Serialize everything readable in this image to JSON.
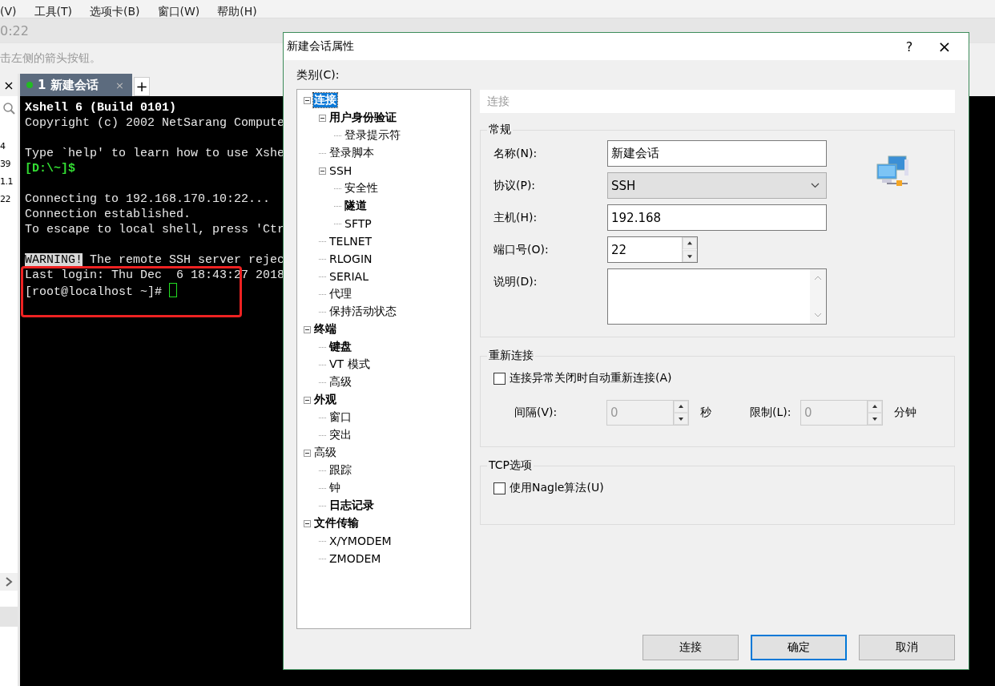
{
  "menu_bar": {
    "items": [
      "(V)",
      "工具(T)",
      "选项卡(B)",
      "窗口(W)",
      "帮助(H)"
    ]
  },
  "address_bar": {
    "value": "0:22"
  },
  "hint_bar": {
    "text": "击左侧的箭头按钮。"
  },
  "side_panel": {
    "close": "×",
    "entries": [
      "4",
      "39",
      "1.1",
      "22"
    ]
  },
  "session_tabs": [
    {
      "label": "1 新建会话",
      "connected": true,
      "selected": true,
      "close": "×"
    }
  ],
  "add_tab": "+",
  "terminal": {
    "lines": [
      {
        "kind": "bold",
        "text": "Xshell 6 (Build 0101)"
      },
      {
        "kind": "plain",
        "text": "Copyright (c) 2002 NetSarang Compute"
      },
      {
        "kind": "blank"
      },
      {
        "kind": "plain",
        "text": "Type `help' to learn how to use Xshe"
      },
      {
        "kind": "prompt",
        "text": "[D:\\~]$"
      },
      {
        "kind": "blank"
      },
      {
        "kind": "plain",
        "text": "Connecting to 192.168.170.10:22..."
      },
      {
        "kind": "plain",
        "text": "Connection established."
      },
      {
        "kind": "plain",
        "text": "To escape to local shell, press 'Ctr"
      },
      {
        "kind": "blank"
      },
      {
        "kind": "warning",
        "highlight": "WARNING!",
        "text": " The remote SSH server rejec"
      },
      {
        "kind": "plain",
        "text": "Last login: Thu Dec  6 18:43:27 2018"
      },
      {
        "kind": "input",
        "text": "[root@localhost ~]# "
      }
    ]
  },
  "dialog": {
    "title": "新建会话属性",
    "help": "?",
    "close": "×",
    "category_label": "类别(C):",
    "tree": [
      {
        "label": "连接",
        "bold": true,
        "selected": true,
        "expanded": true,
        "children": [
          {
            "label": "用户身份验证",
            "bold": true,
            "selected": false,
            "expanded": true,
            "children": [
              {
                "label": "登录提示符",
                "bold": false,
                "selected": false
              }
            ]
          },
          {
            "label": "登录脚本",
            "bold": false,
            "selected": false
          },
          {
            "label": "SSH",
            "bold": false,
            "selected": false,
            "expanded": true,
            "children": [
              {
                "label": "安全性",
                "bold": false,
                "selected": false
              },
              {
                "label": "隧道",
                "bold": true,
                "selected": false
              },
              {
                "label": "SFTP",
                "bold": false,
                "selected": false
              }
            ]
          },
          {
            "label": "TELNET",
            "bold": false,
            "selected": false
          },
          {
            "label": "RLOGIN",
            "bold": false,
            "selected": false
          },
          {
            "label": "SERIAL",
            "bold": false,
            "selected": false
          },
          {
            "label": "代理",
            "bold": false,
            "selected": false
          },
          {
            "label": "保持活动状态",
            "bold": false,
            "selected": false
          }
        ]
      },
      {
        "label": "终端",
        "bold": true,
        "selected": false,
        "expanded": true,
        "children": [
          {
            "label": "键盘",
            "bold": true,
            "selected": false
          },
          {
            "label": "VT 模式",
            "bold": false,
            "selected": false
          },
          {
            "label": "高级",
            "bold": false,
            "selected": false
          }
        ]
      },
      {
        "label": "外观",
        "bold": true,
        "selected": false,
        "expanded": true,
        "children": [
          {
            "label": "窗口",
            "bold": false,
            "selected": false
          },
          {
            "label": "突出",
            "bold": false,
            "selected": false
          }
        ]
      },
      {
        "label": "高级",
        "bold": false,
        "selected": false,
        "expanded": true,
        "children": [
          {
            "label": "跟踪",
            "bold": false,
            "selected": false
          },
          {
            "label": "钟",
            "bold": false,
            "selected": false
          },
          {
            "label": "日志记录",
            "bold": true,
            "selected": false
          }
        ]
      },
      {
        "label": "文件传输",
        "bold": true,
        "selected": false,
        "expanded": true,
        "children": [
          {
            "label": "X/YMODEM",
            "bold": false,
            "selected": false
          },
          {
            "label": "ZMODEM",
            "bold": false,
            "selected": false
          }
        ]
      }
    ],
    "page_title": "连接",
    "general": {
      "title": "常规",
      "fields": [
        {
          "kind": "text",
          "label": "名称(N):",
          "value": "新建会话"
        },
        {
          "kind": "select",
          "label": "协议(P):",
          "value": "SSH"
        },
        {
          "kind": "text",
          "label": "主机(H):",
          "value": "192.168"
        },
        {
          "kind": "spin",
          "label": "端口号(O):",
          "value": "22"
        },
        {
          "kind": "textarea",
          "label": "说明(D):"
        }
      ]
    },
    "reconnect": {
      "title": "重新连接",
      "checkbox": {
        "label": "连接异常关闭时自动重新连接(A)",
        "checked": false
      },
      "spins": [
        {
          "label": "间隔(V):",
          "value": "0",
          "unit": "秒",
          "disabled": true
        },
        {
          "label": "限制(L):",
          "value": "0",
          "unit": "分钟",
          "disabled": true
        }
      ]
    },
    "tcp": {
      "title": "TCP选项",
      "checkbox": {
        "label": "使用Nagle算法(U)",
        "checked": false
      }
    },
    "buttons": [
      {
        "label": "连接",
        "default": false
      },
      {
        "label": "确定",
        "default": true
      },
      {
        "label": "取消",
        "default": false
      }
    ]
  }
}
